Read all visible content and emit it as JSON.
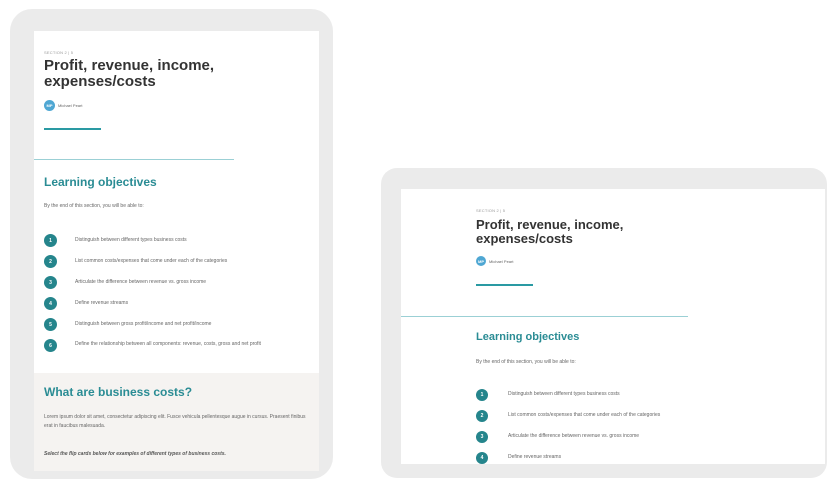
{
  "lesson": {
    "crumb": "SECTION 2 | 5",
    "title_line1": "Profit, revenue, income,",
    "title_line2": "expenses/costs",
    "author_initials": "MP",
    "author_name": "Michael Peart",
    "objectives_heading": "Learning objectives",
    "objectives_intro": "By the end of this section, you will be able to:",
    "objectives": [
      {
        "num": "1",
        "text": "Distinguish between different types business costs"
      },
      {
        "num": "2",
        "text": "List common costs/expenses that come under each of the categories"
      },
      {
        "num": "3",
        "text": "Articulate the difference between revenue vs. gross income"
      },
      {
        "num": "4",
        "text": "Define revenue streams"
      },
      {
        "num": "5",
        "text": "Distinguish between gross profit/income and net profit/income"
      },
      {
        "num": "6",
        "text": "Define the relationship between all components: revenue, costs, gross and net profit"
      }
    ],
    "costs_heading": "What are business costs?",
    "costs_body": "Lorem ipsum dolor sit amet, consectetur adipiscing elit. Fusce vehicula pellentesque augue in cursus. Praesent finibus erat in faucibus malesuada.",
    "flip_note": "Select the flip cards below for examples of different types of business costs."
  },
  "colors": {
    "accent": "#2a9aa3",
    "objective_number": "#25858c",
    "heading": "#2a8c94",
    "avatar": "#4fa7d3",
    "device_frame": "#ebebeb"
  }
}
